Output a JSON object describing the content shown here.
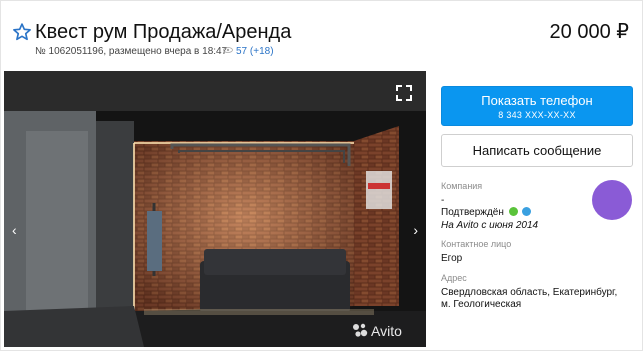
{
  "listing": {
    "title": "Квест рум Продажа/Аренда",
    "price": "20 000 ₽",
    "meta": "№ 1062051196, размещено вчера в 18:47",
    "views_total": "57",
    "views_new": "(+18)"
  },
  "gallery": {
    "prev_icon": "‹",
    "next_icon": "›",
    "watermark": "Avito"
  },
  "actions": {
    "phone_button": "Показать телефон",
    "phone_masked": "8 343 XXX-XX-XX",
    "message_button": "Написать сообщение"
  },
  "seller": {
    "company_label": "Компания",
    "company_value": "-",
    "verified_text": "Подтверждён",
    "since": "На Avito с июня 2014",
    "contact_label": "Контактное лицо",
    "contact_name": "Егор",
    "address_label": "Адрес",
    "address_line1": "Свердловская область, Екатеринбург,",
    "address_line2": "м. Геологическая"
  },
  "colors": {
    "accent_blue": "#0a96f0",
    "link_blue": "#2b74c7",
    "avatar_purple": "#8a5bd6",
    "phone_badge": "#5ac33a",
    "email_badge": "#3aa0e0"
  }
}
